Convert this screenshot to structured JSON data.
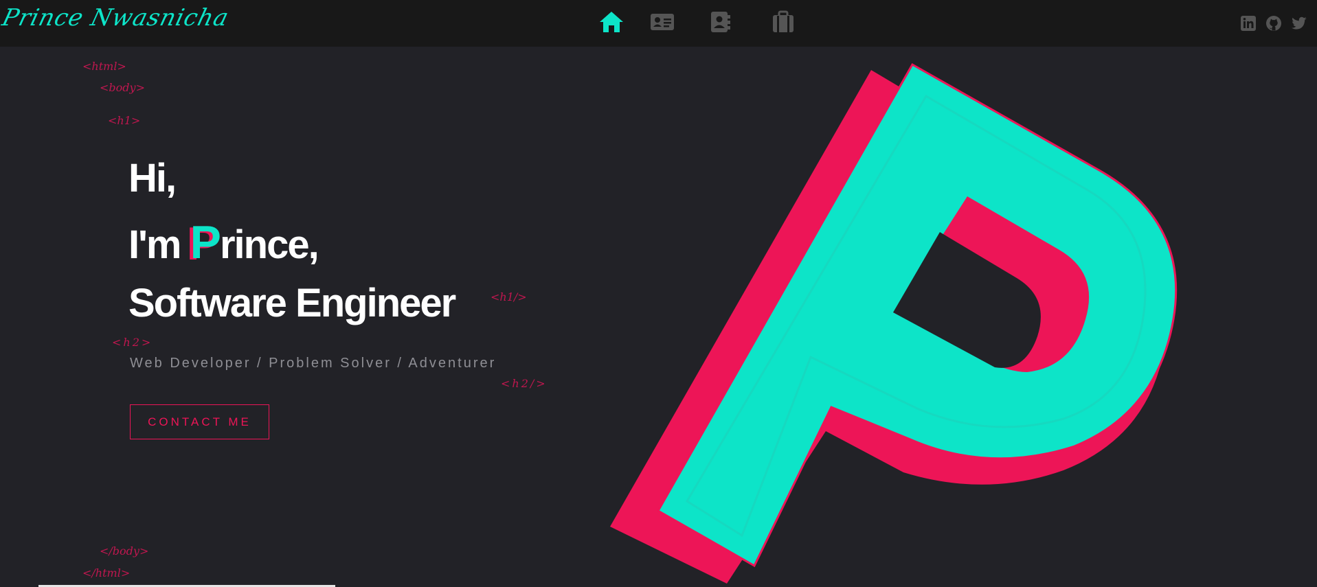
{
  "header": {
    "logo_text": "Prince Nwasnicha",
    "nav": [
      {
        "name": "home",
        "icon": "home-icon",
        "active": true
      },
      {
        "name": "about",
        "icon": "id-card-icon",
        "active": false
      },
      {
        "name": "contact",
        "icon": "address-book-icon",
        "active": false
      },
      {
        "name": "portfolio",
        "icon": "briefcase-icon",
        "active": false
      }
    ],
    "social": [
      {
        "name": "linkedin",
        "icon": "linkedin-icon"
      },
      {
        "name": "github",
        "icon": "github-icon"
      },
      {
        "name": "twitter",
        "icon": "twitter-icon"
      }
    ]
  },
  "tags": {
    "html_open": "<html>",
    "body_open": "<body>",
    "h1_open": "<h1>",
    "h1_close": "<h1/>",
    "h2_open": "<h2>",
    "h2_close": "<h2/>",
    "body_close": "</body>",
    "html_close": "</html>"
  },
  "hero": {
    "line1": "Hi,",
    "line2_prefix": "I'm",
    "line2_accent": "P",
    "line2_rest": "rince,",
    "line3": "Software Engineer",
    "subtitle": "Web Developer / Problem Solver / Adventurer",
    "cta_label": "CONTACT ME"
  },
  "colors": {
    "background": "#222227",
    "topbar": "#181818",
    "accent_teal": "#0de4c8",
    "accent_pink": "#ed1557",
    "icon_gray": "#555555"
  }
}
